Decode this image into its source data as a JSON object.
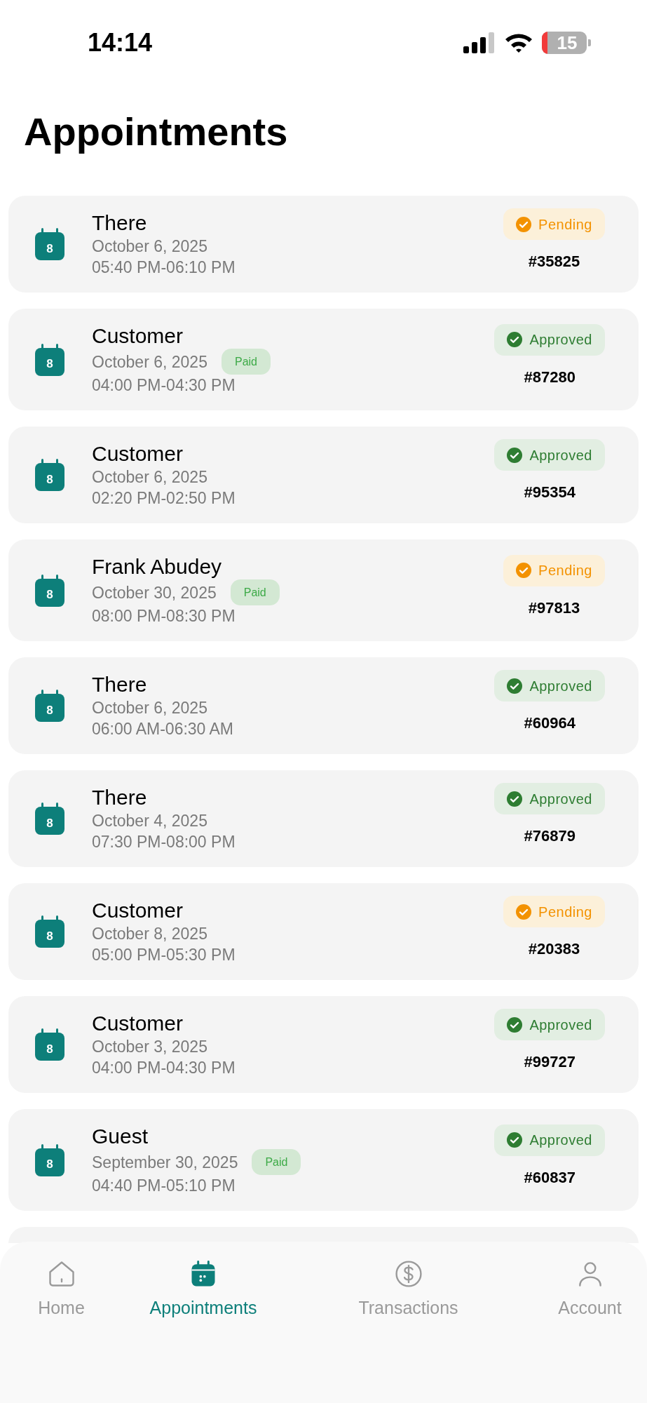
{
  "status_bar": {
    "time": "14:14",
    "battery": "15"
  },
  "title": "Appointments",
  "appointments": [
    {
      "icon_day": "8",
      "name": "There",
      "date": "October 6, 2025",
      "paid": false,
      "time": "05:40 PM-06:10 PM",
      "status": {
        "kind": "pending",
        "label": "Pending"
      },
      "number": "#35825"
    },
    {
      "icon_day": "8",
      "name": "Customer",
      "date": "October 6, 2025",
      "paid": true,
      "paid_label": "Paid",
      "time": "04:00 PM-04:30 PM",
      "status": {
        "kind": "approved",
        "label": "Approved"
      },
      "number": "#87280"
    },
    {
      "icon_day": "8",
      "name": "Customer",
      "date": "October 6, 2025",
      "paid": false,
      "time": "02:20 PM-02:50 PM",
      "status": {
        "kind": "approved",
        "label": "Approved"
      },
      "number": "#95354"
    },
    {
      "icon_day": "8",
      "name": "Frank Abudey",
      "date": "October 30, 2025",
      "paid": true,
      "paid_label": "Paid",
      "time": "08:00 PM-08:30 PM",
      "status": {
        "kind": "pending",
        "label": "Pending"
      },
      "number": "#97813"
    },
    {
      "icon_day": "8",
      "name": "There",
      "date": "October 6, 2025",
      "paid": false,
      "time": "06:00 AM-06:30 AM",
      "status": {
        "kind": "approved",
        "label": "Approved"
      },
      "number": "#60964"
    },
    {
      "icon_day": "8",
      "name": "There",
      "date": "October 4, 2025",
      "paid": false,
      "time": "07:30 PM-08:00 PM",
      "status": {
        "kind": "approved",
        "label": "Approved"
      },
      "number": "#76879"
    },
    {
      "icon_day": "8",
      "name": "Customer",
      "date": "October 8, 2025",
      "paid": false,
      "time": "05:00 PM-05:30 PM",
      "status": {
        "kind": "pending",
        "label": "Pending"
      },
      "number": "#20383"
    },
    {
      "icon_day": "8",
      "name": "Customer",
      "date": "October 3, 2025",
      "paid": false,
      "time": "04:00 PM-04:30 PM",
      "status": {
        "kind": "approved",
        "label": "Approved"
      },
      "number": "#99727"
    },
    {
      "icon_day": "8",
      "name": "Guest",
      "date": "September 30, 2025",
      "paid": true,
      "paid_label": "Paid",
      "time": "04:40 PM-05:10 PM",
      "status": {
        "kind": "approved",
        "label": "Approved"
      },
      "number": "#60837"
    }
  ],
  "tab_bar": [
    {
      "kind": "home",
      "label": "Home",
      "selected": false
    },
    {
      "kind": "appointments",
      "label": "Appointments",
      "selected": true
    },
    {
      "kind": "transactions",
      "label": "Transactions",
      "selected": false
    },
    {
      "kind": "account",
      "label": "Account",
      "selected": false
    }
  ]
}
